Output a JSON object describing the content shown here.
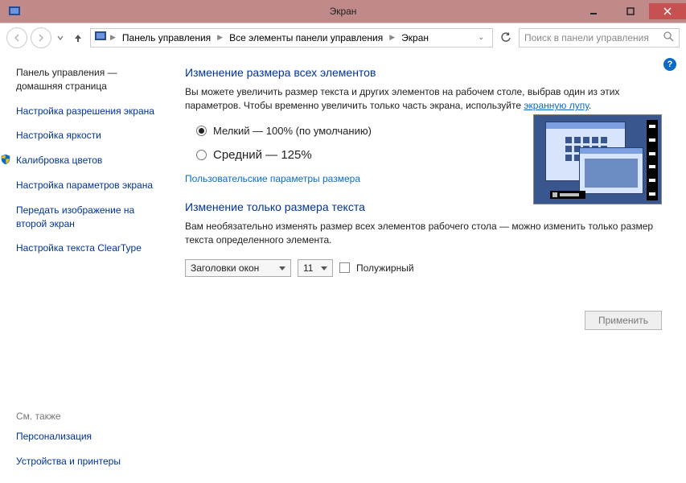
{
  "title": "Экран",
  "breadcrumb": {
    "c1": "Панель управления",
    "c2": "Все элементы панели управления",
    "c3": "Экран"
  },
  "search_placeholder": "Поиск в панели управления",
  "sidebar": {
    "home": "Панель управления — домашняя страница",
    "items": [
      "Настройка разрешения экрана",
      "Настройка яркости",
      "Калибровка цветов",
      "Настройка параметров экрана",
      "Передать изображение на второй экран",
      "Настройка текста ClearType"
    ],
    "see_also": "См. также",
    "related": [
      "Персонализация",
      "Устройства и принтеры"
    ]
  },
  "main": {
    "h1": "Изменение размера всех элементов",
    "para_a": "Вы можете увеличить размер текста и других элементов на рабочем столе, выбрав один из этих параметров. Чтобы временно увеличить только часть экрана, используйте ",
    "para_link": "экранную лупу",
    "para_b": ".",
    "radio1": "Мелкий — 100% (по умолчанию)",
    "radio2": "Средний — 125%",
    "custom_link": "Пользовательские параметры размера",
    "h2": "Изменение только размера текста",
    "para2": "Вам необязательно изменять размер всех элементов рабочего стола — можно изменить только размер текста определенного элемента.",
    "select_element": "Заголовки окон",
    "select_size": "11",
    "bold_label": "Полужирный",
    "apply": "Применить"
  }
}
